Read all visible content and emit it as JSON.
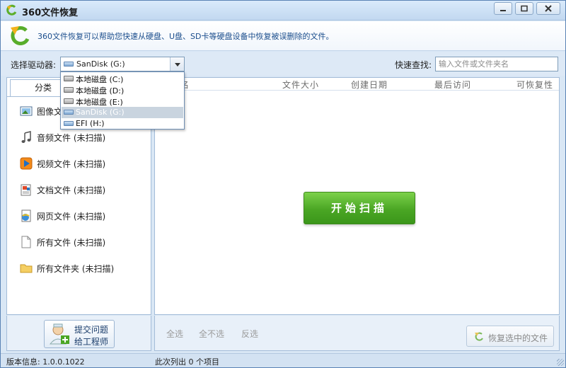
{
  "window": {
    "title": "360文件恢复"
  },
  "info": {
    "text": "360文件恢复可以帮助您快速从硬盘、U盘、SD卡等硬盘设备中恢复被误删除的文件。"
  },
  "toolbar": {
    "drive_label": "选择驱动器:",
    "drive_selected": "SanDisk (G:)",
    "search_label": "快速查找:",
    "search_placeholder": "输入文件或文件夹名",
    "search_value": ""
  },
  "drives": [
    {
      "label": "本地磁盘 (C:)",
      "icon": "hard-disk-icon"
    },
    {
      "label": "本地磁盘 (D:)",
      "icon": "hard-disk-icon"
    },
    {
      "label": "本地磁盘 (E:)",
      "icon": "hard-disk-icon"
    },
    {
      "label": "SanDisk (G:)",
      "icon": "usb-drive-icon",
      "selected": true
    },
    {
      "label": "EFI (H:)",
      "icon": "usb-drive-icon"
    }
  ],
  "left": {
    "tab_label": "分类",
    "categories": [
      {
        "label": "图像文件 (未扫描)",
        "icon": "image-icon"
      },
      {
        "label": "音频文件 (未扫描)",
        "icon": "music-note-icon"
      },
      {
        "label": "视频文件 (未扫描)",
        "icon": "video-icon"
      },
      {
        "label": "文档文件 (未扫描)",
        "icon": "document-icon"
      },
      {
        "label": "网页文件 (未扫描)",
        "icon": "web-page-icon"
      },
      {
        "label": "所有文件 (未扫描)",
        "icon": "blank-file-icon"
      },
      {
        "label": "所有文件夹 (未扫描)",
        "icon": "folder-icon"
      }
    ],
    "engineer_line1": "提交问题",
    "engineer_line2": "给工程师"
  },
  "table": {
    "columns": [
      "名",
      "文件大小",
      "创建日期",
      "最后访问",
      "可恢复性"
    ]
  },
  "scan": {
    "label": "开始扫描"
  },
  "selection": {
    "all": "全选",
    "none": "全不选",
    "invert": "反选"
  },
  "restore": {
    "label": "恢复选中的文件"
  },
  "status": {
    "version": "版本信息: 1.0.0.1022",
    "count": "此次列出 0 个项目"
  },
  "colors": {
    "accent_green": "#4aa624",
    "frame_blue": "#d9e7f5",
    "selection_gray": "#c9d4df"
  }
}
